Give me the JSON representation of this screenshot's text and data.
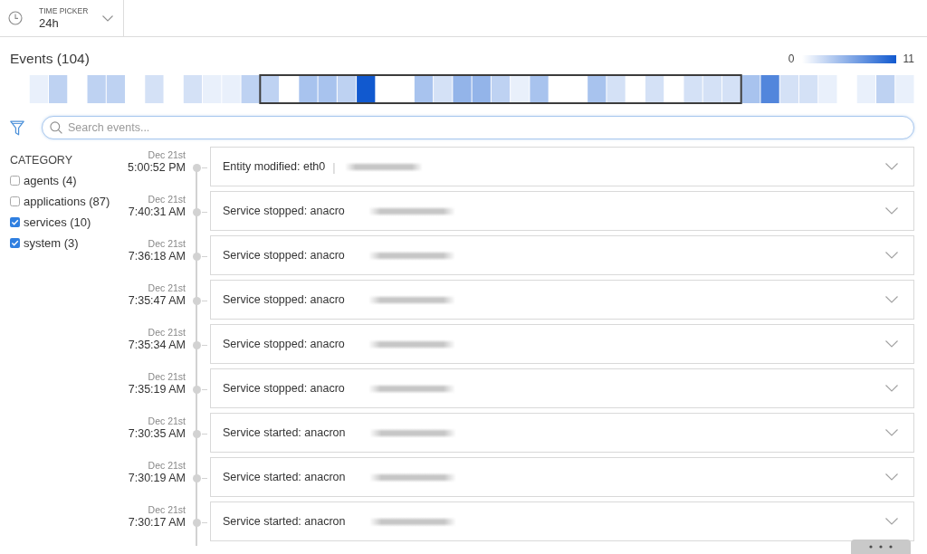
{
  "time_picker": {
    "label": "TIME PICKER",
    "value": "24h"
  },
  "events_panel": {
    "title": "Events (104)",
    "scale_labels": [
      "0",
      "11"
    ]
  },
  "search": {
    "placeholder": "Search events..."
  },
  "category_filter": {
    "title": "CATEGORY",
    "items": [
      {
        "label": "agents (4)",
        "checked": false
      },
      {
        "label": "applications (87)",
        "checked": false
      },
      {
        "label": "services (10)",
        "checked": true
      },
      {
        "label": "system (3)",
        "checked": true
      }
    ]
  },
  "events": [
    {
      "date": "Dec 21st",
      "time": "5:00:52 PM",
      "title": "Entity modified: eth0",
      "separator": "|",
      "redacted": true
    },
    {
      "date": "Dec 21st",
      "time": "7:40:31 AM",
      "title": "Service stopped: anacro",
      "redacted": true
    },
    {
      "date": "Dec 21st",
      "time": "7:36:18 AM",
      "title": "Service stopped: anacro",
      "redacted": true
    },
    {
      "date": "Dec 21st",
      "time": "7:35:47 AM",
      "title": "Service stopped: anacro",
      "redacted": true
    },
    {
      "date": "Dec 21st",
      "time": "7:35:34 AM",
      "title": "Service stopped: anacro",
      "redacted": true
    },
    {
      "date": "Dec 21st",
      "time": "7:35:19 AM",
      "title": "Service stopped: anacro",
      "redacted": true
    },
    {
      "date": "Dec 21st",
      "time": "7:30:35 AM",
      "title": "Service started: anacron",
      "redacted": true
    },
    {
      "date": "Dec 21st",
      "time": "7:30:19 AM",
      "title": "Service started: anacron",
      "redacted": true
    },
    {
      "date": "Dec 21st",
      "time": "7:30:17 AM",
      "title": "Service started: anacron",
      "redacted": true
    }
  ]
}
